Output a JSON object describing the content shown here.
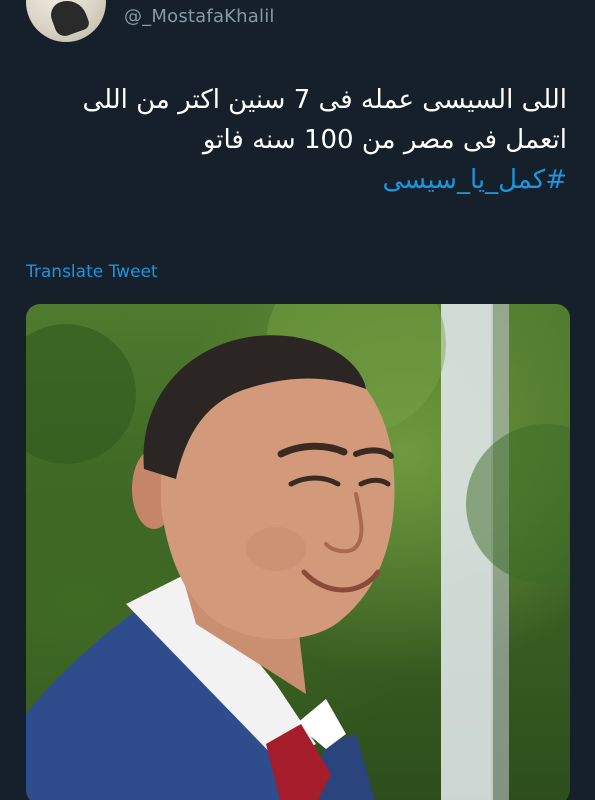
{
  "tweet": {
    "handle": "@_MostafaKhalil",
    "text_lines": [
      "اللى السيسى عمله فى 7 سنين اكتر من اللى",
      "اتعمل فى مصر من 100 سنه فاتو"
    ],
    "hashtag": "#كمل_يا_سيسى",
    "translate_label": "Translate Tweet"
  },
  "media": {
    "description_icon": "photo-icon"
  },
  "colors": {
    "background": "#15202b",
    "text": "#ffffff",
    "secondary": "#8899a6",
    "link": "#1b95e0"
  }
}
